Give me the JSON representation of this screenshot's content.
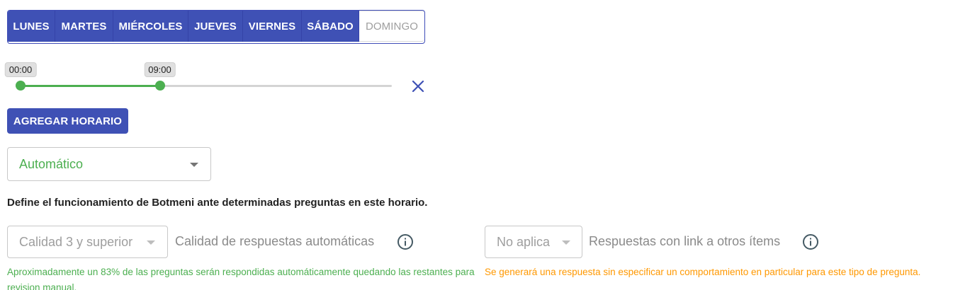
{
  "days": [
    {
      "label": "LUNES",
      "active": true
    },
    {
      "label": "MARTES",
      "active": true
    },
    {
      "label": "MIÉRCOLES",
      "active": true
    },
    {
      "label": "JUEVES",
      "active": true
    },
    {
      "label": "VIERNES",
      "active": true
    },
    {
      "label": "SÁBADO",
      "active": true
    },
    {
      "label": "DOMINGO",
      "active": false
    }
  ],
  "schedule": {
    "start_label": "00:00",
    "end_label": "09:00",
    "start_fraction": 0.0,
    "end_fraction": 0.375
  },
  "add_schedule_label": "AGREGAR HORARIO",
  "mode_select": {
    "value": "Automático"
  },
  "description": "Define el funcionamiento de Botmeni ante determinadas preguntas en este horario.",
  "quality": {
    "select_value": "Calidad 3 y superior",
    "label": "Calidad de respuestas automáticas",
    "help": "Aproximadamente un 83% de las preguntas serán respondidas automáticamente quedando las restantes para revision manual."
  },
  "links": {
    "select_value": "No aplica",
    "label": "Respuestas con link a otros ítems",
    "help": "Se generará una respuesta sin especificar un comportamiento en particular para este tipo de pregunta."
  },
  "colors": {
    "primary": "#3f51b5",
    "success": "#4caf50",
    "warning": "#ff9800"
  },
  "icons": {
    "remove": "close-icon",
    "dropdown": "caret-down-icon",
    "info": "info-icon"
  }
}
